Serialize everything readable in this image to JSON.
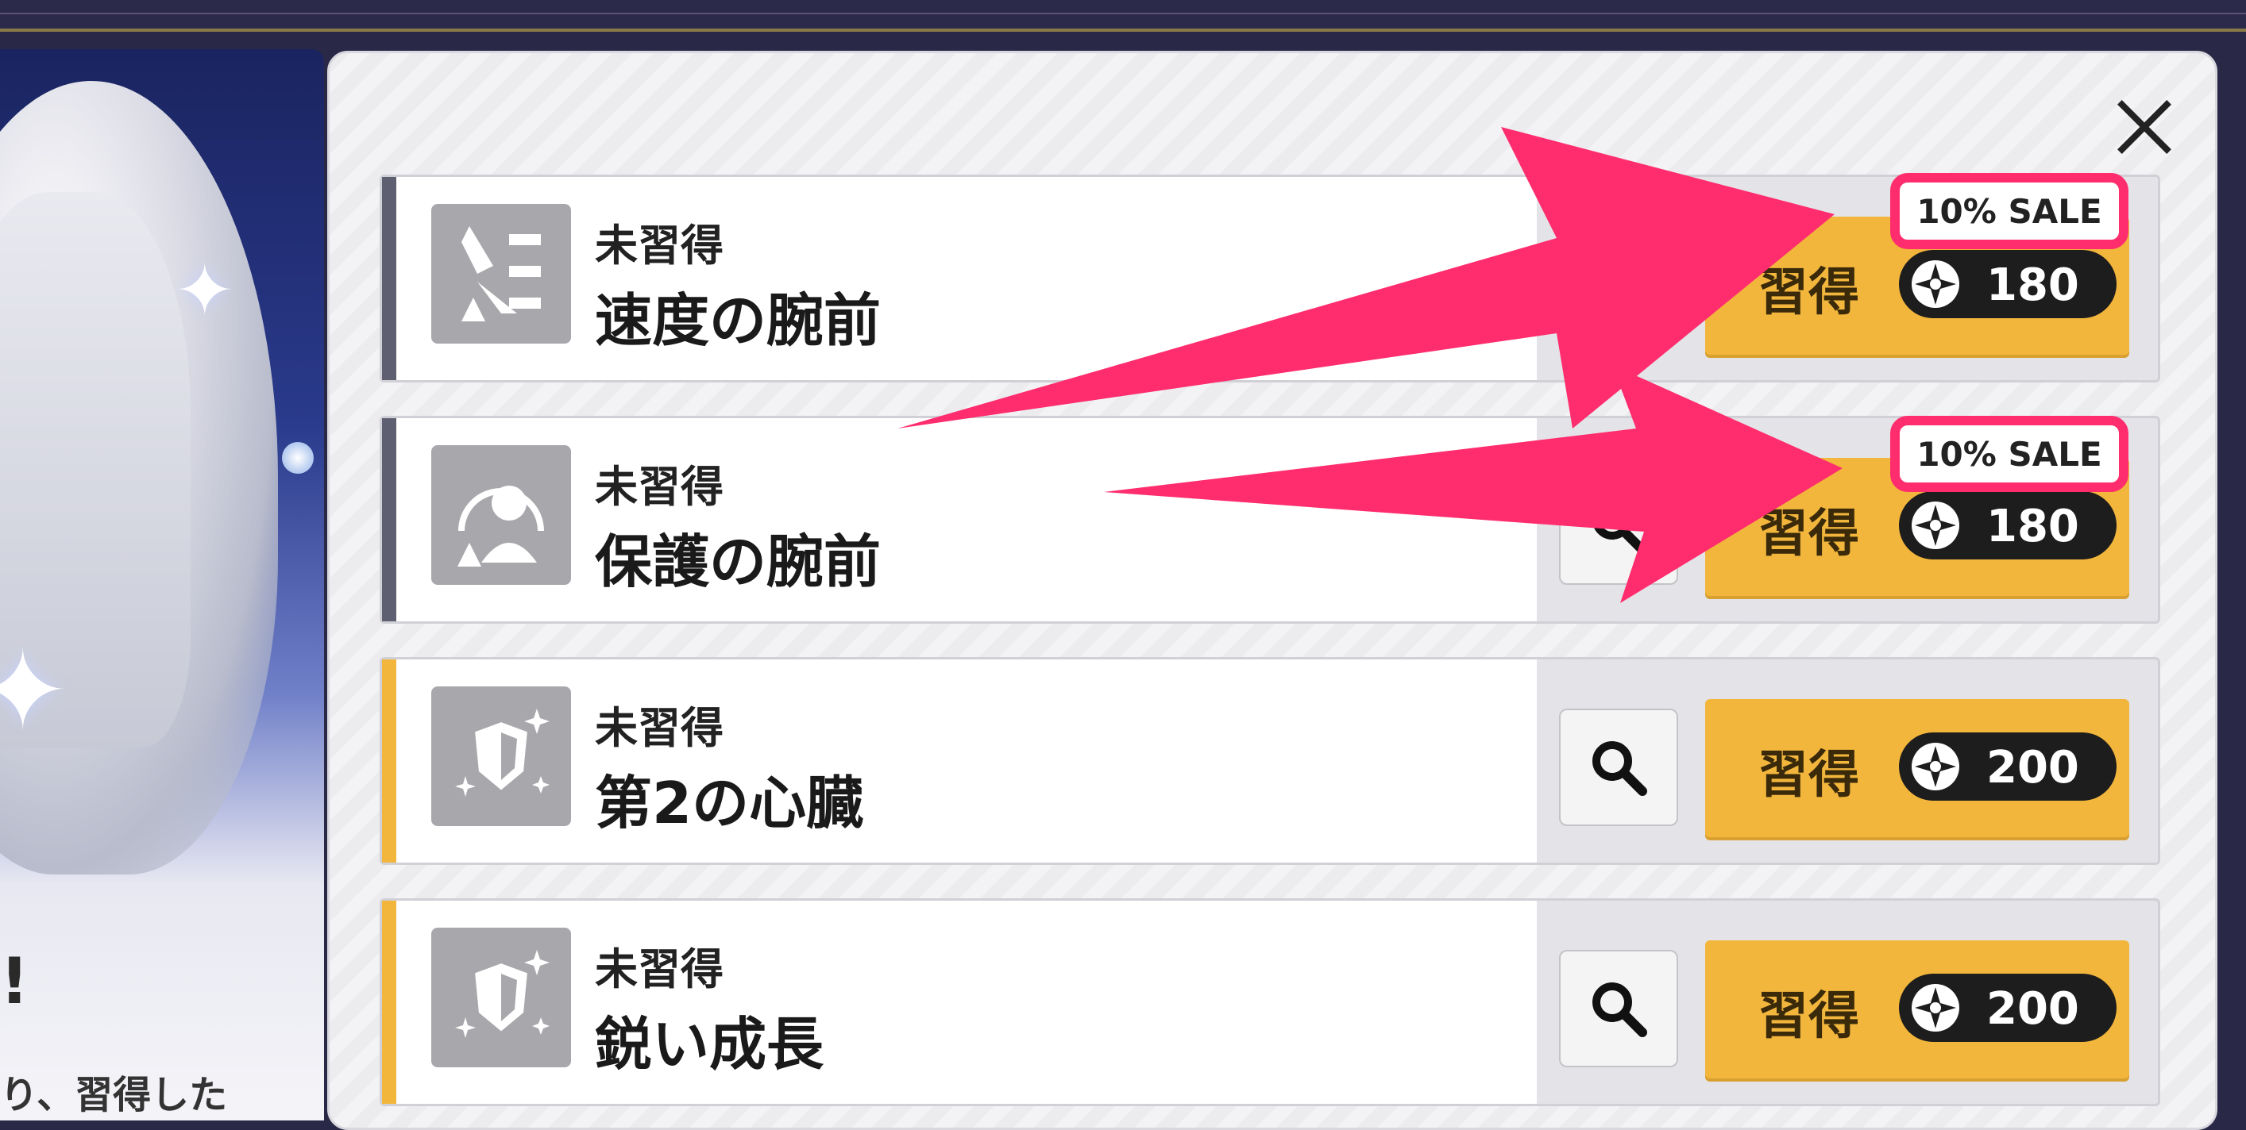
{
  "colors": {
    "accent_gray": "#5f5f72",
    "accent_gold": "#f3b63c",
    "learn_button": "#f3b63c",
    "sale_highlight": "#ff2d6e",
    "cost_pill": "#1d1d1d"
  },
  "left_panel": {
    "glyph": "!",
    "description": "り、習得した"
  },
  "dialog": {
    "close_icon": "close-icon"
  },
  "skills": [
    {
      "status": "未習得",
      "name": "速度の腕前",
      "learn_label": "習得",
      "cost": "180",
      "sale": "10% SALE",
      "icon": "sword-speed-icon",
      "accent": "gray"
    },
    {
      "status": "未習得",
      "name": "保護の腕前",
      "learn_label": "習得",
      "cost": "180",
      "sale": "10% SALE",
      "icon": "guardian-person-icon",
      "accent": "gray"
    },
    {
      "status": "未習得",
      "name": "第2の心臓",
      "learn_label": "習得",
      "cost": "200",
      "icon": "shield-sparkle-icon",
      "accent": "gold"
    },
    {
      "status": "未習得",
      "name": "鋭い成長",
      "learn_label": "習得",
      "cost": "200",
      "icon": "shield-sparkle-icon",
      "accent": "gold"
    }
  ]
}
